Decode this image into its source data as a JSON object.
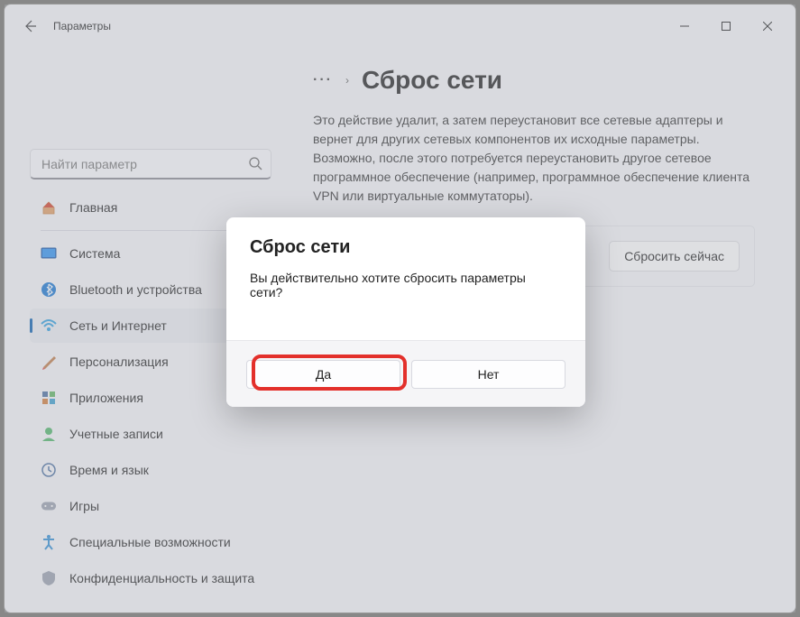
{
  "window_title": "Параметры",
  "search": {
    "placeholder": "Найти параметр"
  },
  "sidebar": {
    "items": [
      {
        "label": "Главная"
      },
      {
        "label": "Система"
      },
      {
        "label": "Bluetooth и устройства"
      },
      {
        "label": "Сеть и Интернет"
      },
      {
        "label": "Персонализация"
      },
      {
        "label": "Приложения"
      },
      {
        "label": "Учетные записи"
      },
      {
        "label": "Время и язык"
      },
      {
        "label": "Игры"
      },
      {
        "label": "Специальные возможности"
      },
      {
        "label": "Конфиденциальность и защита"
      }
    ]
  },
  "breadcrumb": {
    "ellipsis": "···",
    "chevron": "›",
    "title": "Сброс сети"
  },
  "description": "Это действие удалит, а затем переустановит все сетевые адаптеры и вернет для других сетевых компонентов их исходные параметры. Возможно, после этого потребуется переустановить другое сетевое программное обеспечение (например, программное обеспечение клиента VPN или виртуальные коммутаторы).",
  "reset_button": "Сбросить сейчас",
  "dialog": {
    "title": "Сброс сети",
    "message": "Вы действительно хотите сбросить параметры сети?",
    "yes": "Да",
    "no": "Нет"
  }
}
